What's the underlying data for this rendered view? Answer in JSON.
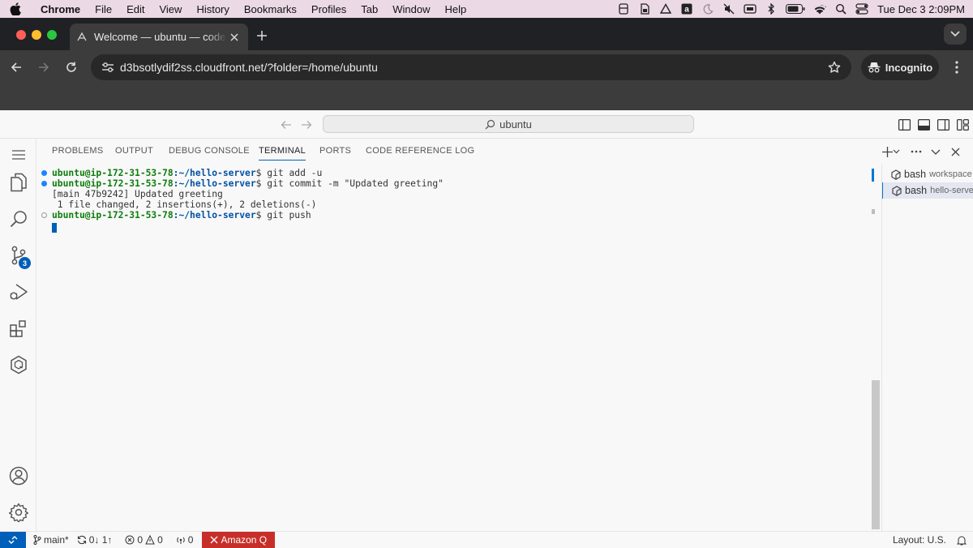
{
  "menubar": {
    "app": "Chrome",
    "items": [
      "File",
      "Edit",
      "View",
      "History",
      "Bookmarks",
      "Profiles",
      "Tab",
      "Window",
      "Help"
    ],
    "clock": "Tue Dec 3  2:09PM"
  },
  "browser": {
    "tab_title": "Welcome — ubuntu — code-server",
    "url": "d3bsotlydif2ss.cloudfront.net/?folder=/home/ubuntu",
    "incognito_label": "Incognito"
  },
  "vscode": {
    "command_center": "ubuntu",
    "panel_tabs": [
      "PROBLEMS",
      "OUTPUT",
      "DEBUG CONSOLE",
      "TERMINAL",
      "PORTS",
      "CODE REFERENCE LOG"
    ],
    "active_tab": "TERMINAL",
    "source_control_badge": "3",
    "terminal": {
      "lines": [
        {
          "prompt": "ubuntu@ip-172-31-53-78",
          "path": ":~/hello-server",
          "cmd": "$ git add -u"
        },
        {
          "prompt": "ubuntu@ip-172-31-53-78",
          "path": ":~/hello-server",
          "cmd": "$ git commit -m \"Updated greeting\""
        },
        {
          "text": "[main 47b9242] Updated greeting"
        },
        {
          "text": " 1 file changed, 2 insertions(+), 2 deletions(-)"
        },
        {
          "prompt": "ubuntu@ip-172-31-53-78",
          "path": ":~/hello-server",
          "cmd": "$ git push"
        }
      ]
    },
    "terminal_list": [
      {
        "name": "bash",
        "desc": "workspace"
      },
      {
        "name": "bash",
        "desc": "hello-server"
      }
    ],
    "status": {
      "branch": "main*",
      "sync": "0↓ 1↑",
      "errors": "0",
      "warnings": "0",
      "ports": "0",
      "amazon_q": "Amazon Q",
      "layout": "Layout: U.S."
    }
  },
  "colors": {
    "accent": "#005fb8",
    "prompt_green": "#0e7c0e",
    "path_blue": "#0451a5",
    "amazon_q_red": "#c72e29"
  }
}
